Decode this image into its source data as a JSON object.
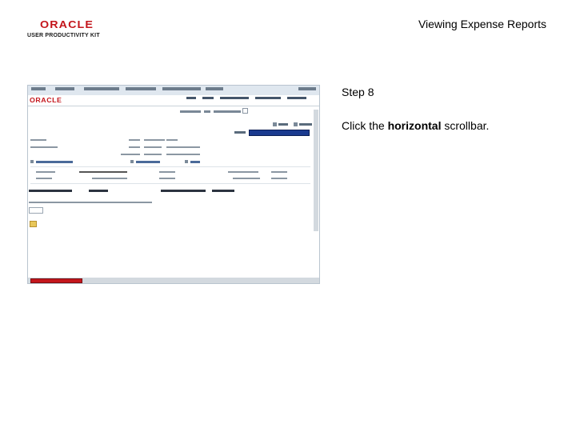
{
  "logo": {
    "brand": "ORACLE",
    "subtitle": "USER PRODUCTIVITY KIT"
  },
  "document_title": "Viewing Expense Reports",
  "step": {
    "label": "Step 8"
  },
  "instruction": {
    "prefix": "Click the ",
    "emphasis": "horizontal",
    "suffix": " scrollbar."
  },
  "screenshot": {
    "brand": "ORACLE"
  },
  "colors": {
    "oracle_red": "#c4161c",
    "actions_blue": "#1a3a8f",
    "nav_bg": "#dfe7ef"
  }
}
